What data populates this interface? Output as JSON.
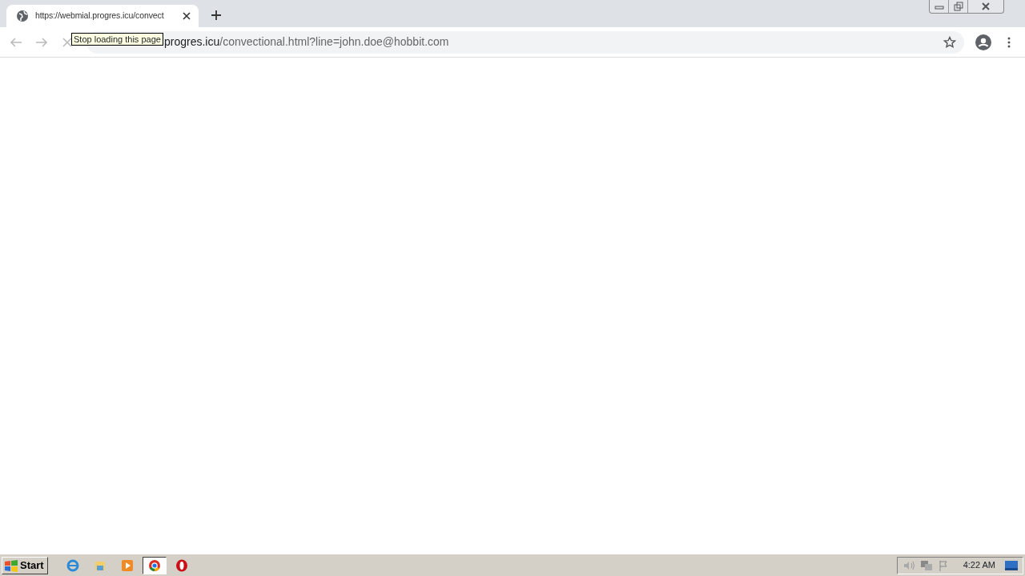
{
  "tabs": [
    {
      "title": "https://webmial.progres.icu/convect",
      "selected": true
    }
  ],
  "address_bar": {
    "host": "progres.icu",
    "path": "/convectional.html?line=john.doe@hobbit.com"
  },
  "tooltip": "Stop loading this page",
  "taskbar": {
    "start": "Start",
    "apps": [
      {
        "kind": "ie",
        "selected": false
      },
      {
        "kind": "explorer",
        "selected": false
      },
      {
        "kind": "media",
        "selected": false
      },
      {
        "kind": "chrome",
        "selected": true
      },
      {
        "kind": "opera",
        "selected": false
      }
    ],
    "clock": "4:22 AM"
  }
}
